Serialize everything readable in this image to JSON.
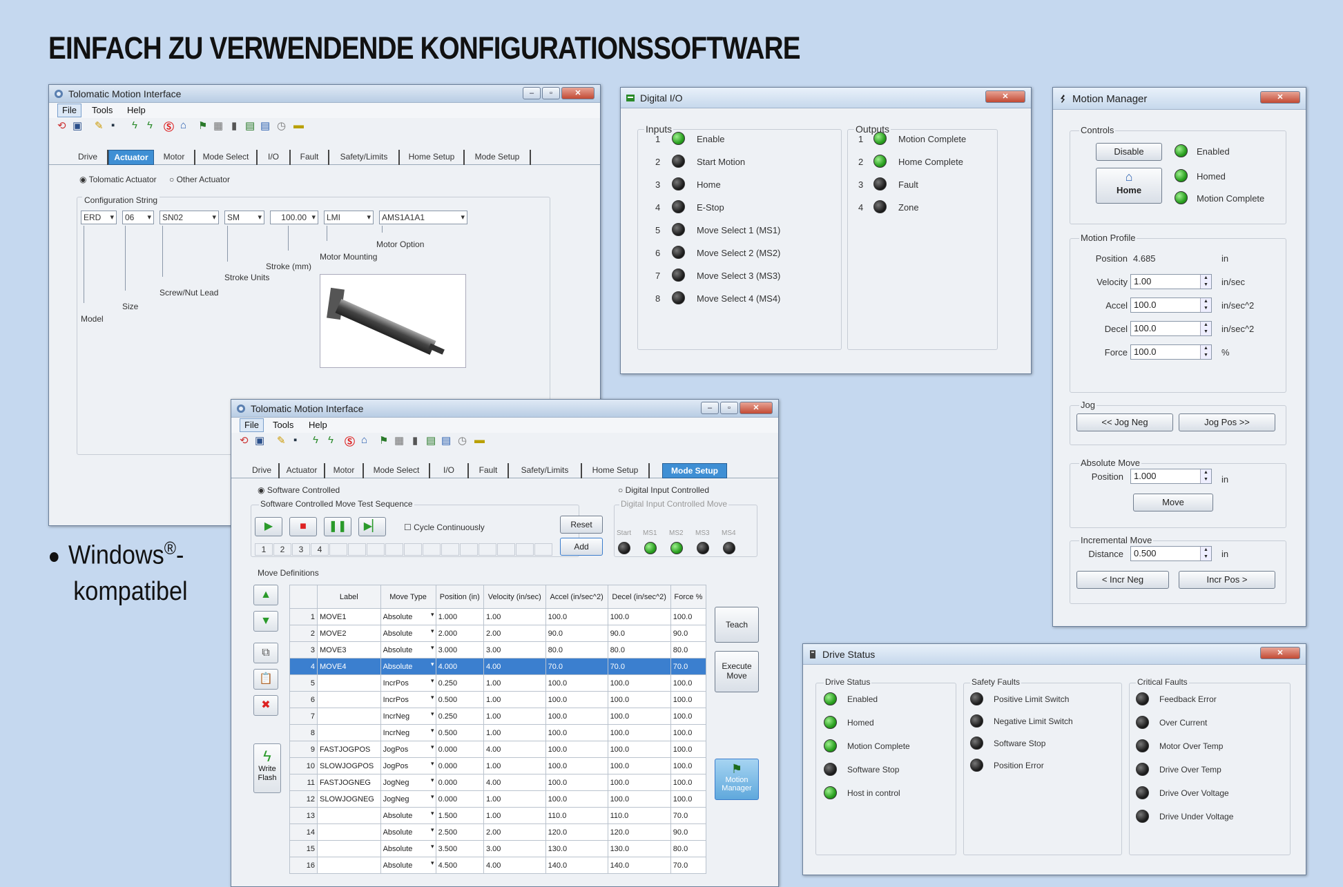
{
  "heading": "EINFACH ZU VERWENDENDE KONFIGURATIONSSOFTWARE",
  "bullet": {
    "line1": "Windows",
    "sup": "®",
    "dash": "-",
    "line2": "kompatibel"
  },
  "colors": {
    "background": "#c5d8ef",
    "selected_tab": "#3f8fd4",
    "led_on": "#2aa020",
    "led_off": "#222222",
    "selected_row": "#3b7fcf"
  },
  "window1": {
    "title": "Tolomatic Motion Interface",
    "menu": [
      "File",
      "Tools",
      "Help"
    ],
    "tabs": [
      "Drive",
      "Actuator",
      "Motor",
      "Mode Select",
      "I/O",
      "Fault",
      "Safety/Limits",
      "Home Setup",
      "Mode Setup"
    ],
    "selected_tab": "Actuator",
    "radio_tolomatic": "Tolomatic Actuator",
    "radio_other": "Other Actuator",
    "config_label": "Configuration String",
    "combos": [
      "ERD",
      "06",
      "SN02",
      "SM",
      "100.00",
      "LMI",
      "AMS1A1A1"
    ],
    "labels": {
      "model": "Model",
      "size": "Size",
      "screw": "Screw/Nut Lead",
      "stroke_units": "Stroke Units",
      "stroke": "Stroke (mm)",
      "motor_mounting": "Motor Mounting",
      "motor_option": "Motor Option"
    }
  },
  "window2": {
    "title": "Tolomatic Motion Interface",
    "menu": [
      "File",
      "Tools",
      "Help"
    ],
    "tabs": [
      "Drive",
      "Actuator",
      "Motor",
      "Mode Select",
      "I/O",
      "Fault",
      "Safety/Limits",
      "Home Setup",
      "Mode Setup"
    ],
    "selected_tab": "Mode Setup",
    "radio_software": "Software Controlled",
    "radio_digital": "Digital Input Controlled",
    "seq_title": "Software Controlled Move Test Sequence",
    "digital_title": "Digital Input Controlled Move",
    "cycle_label": "Cycle Continuously",
    "reset": "Reset",
    "add": "Add",
    "seq_numbers": [
      "1",
      "2",
      "3",
      "4"
    ],
    "digital_leds": [
      {
        "label": "Start",
        "on": false
      },
      {
        "label": "MS1",
        "on": true
      },
      {
        "label": "MS2",
        "on": true
      },
      {
        "label": "MS3",
        "on": false
      },
      {
        "label": "MS4",
        "on": false
      }
    ],
    "move_defs_label": "Move Definitions",
    "columns": [
      "Label",
      "Move Type",
      "Position (in)",
      "Velocity (in/sec)",
      "Accel (in/sec^2)",
      "Decel (in/sec^2)",
      "Force %"
    ],
    "rows": [
      [
        "1",
        "MOVE1",
        "Absolute",
        "1.000",
        "1.00",
        "100.0",
        "100.0",
        "100.0"
      ],
      [
        "2",
        "MOVE2",
        "Absolute",
        "2.000",
        "2.00",
        "90.0",
        "90.0",
        "90.0"
      ],
      [
        "3",
        "MOVE3",
        "Absolute",
        "3.000",
        "3.00",
        "80.0",
        "80.0",
        "80.0"
      ],
      [
        "4",
        "MOVE4",
        "Absolute",
        "4.000",
        "4.00",
        "70.0",
        "70.0",
        "70.0"
      ],
      [
        "5",
        "",
        "IncrPos",
        "0.250",
        "1.00",
        "100.0",
        "100.0",
        "100.0"
      ],
      [
        "6",
        "",
        "IncrPos",
        "0.500",
        "1.00",
        "100.0",
        "100.0",
        "100.0"
      ],
      [
        "7",
        "",
        "IncrNeg",
        "0.250",
        "1.00",
        "100.0",
        "100.0",
        "100.0"
      ],
      [
        "8",
        "",
        "IncrNeg",
        "0.500",
        "1.00",
        "100.0",
        "100.0",
        "100.0"
      ],
      [
        "9",
        "FASTJOGPOS",
        "JogPos",
        "0.000",
        "4.00",
        "100.0",
        "100.0",
        "100.0"
      ],
      [
        "10",
        "SLOWJOGPOS",
        "JogPos",
        "0.000",
        "1.00",
        "100.0",
        "100.0",
        "100.0"
      ],
      [
        "11",
        "FASTJOGNEG",
        "JogNeg",
        "0.000",
        "4.00",
        "100.0",
        "100.0",
        "100.0"
      ],
      [
        "12",
        "SLOWJOGNEG",
        "JogNeg",
        "0.000",
        "1.00",
        "100.0",
        "100.0",
        "100.0"
      ],
      [
        "13",
        "",
        "Absolute",
        "1.500",
        "1.00",
        "110.0",
        "110.0",
        "70.0"
      ],
      [
        "14",
        "",
        "Absolute",
        "2.500",
        "2.00",
        "120.0",
        "120.0",
        "90.0"
      ],
      [
        "15",
        "",
        "Absolute",
        "3.500",
        "3.00",
        "130.0",
        "130.0",
        "80.0"
      ],
      [
        "16",
        "",
        "Absolute",
        "4.500",
        "4.00",
        "140.0",
        "140.0",
        "70.0"
      ]
    ],
    "selected_row": "4",
    "teach": "Teach",
    "execute_move": "Execute Move",
    "motion_manager_btn": "Motion Manager",
    "write_flash": "Write Flash"
  },
  "digital_io": {
    "title": "Digital I/O",
    "inputs_title": "Inputs",
    "outputs_title": "Outputs",
    "inputs": [
      {
        "num": "1",
        "label": "Enable",
        "on": true
      },
      {
        "num": "2",
        "label": "Start Motion",
        "on": false
      },
      {
        "num": "3",
        "label": "Home",
        "on": false
      },
      {
        "num": "4",
        "label": "E-Stop",
        "on": false
      },
      {
        "num": "5",
        "label": "Move Select 1 (MS1)",
        "on": false
      },
      {
        "num": "6",
        "label": "Move Select 2 (MS2)",
        "on": false
      },
      {
        "num": "7",
        "label": "Move Select 3 (MS3)",
        "on": false
      },
      {
        "num": "8",
        "label": "Move Select 4 (MS4)",
        "on": false
      }
    ],
    "outputs": [
      {
        "num": "1",
        "label": "Motion Complete",
        "on": true
      },
      {
        "num": "2",
        "label": "Home Complete",
        "on": true
      },
      {
        "num": "3",
        "label": "Fault",
        "on": false
      },
      {
        "num": "4",
        "label": "Zone",
        "on": false
      }
    ]
  },
  "motion_manager": {
    "title": "Motion Manager",
    "controls_title": "Controls",
    "disable": "Disable",
    "home": "Home",
    "status": [
      {
        "label": "Enabled",
        "on": true
      },
      {
        "label": "Homed",
        "on": true
      },
      {
        "label": "Motion Complete",
        "on": true
      }
    ],
    "profile_title": "Motion Profile",
    "position_label": "Position",
    "position_value": "4.685",
    "position_unit": "in",
    "velocity_label": "Velocity",
    "velocity_value": "1.00",
    "velocity_unit": "in/sec",
    "accel_label": "Accel",
    "accel_value": "100.0",
    "accel_unit": "in/sec^2",
    "decel_label": "Decel",
    "decel_value": "100.0",
    "decel_unit": "in/sec^2",
    "force_label": "Force",
    "force_value": "100.0",
    "force_unit": "%",
    "jog_title": "Jog",
    "jog_neg": "<<  Jog Neg",
    "jog_pos": "Jog Pos  >>",
    "abs_title": "Absolute Move",
    "abs_position_label": "Position",
    "abs_position_value": "1.000",
    "abs_unit": "in",
    "move": "Move",
    "incr_title": "Incremental Move",
    "distance_label": "Distance",
    "distance_value": "0.500",
    "distance_unit": "in",
    "incr_neg": "<  Incr Neg",
    "incr_pos": "Incr Pos  >"
  },
  "drive_status": {
    "title": "Drive Status",
    "col1_title": "Drive Status",
    "col1": [
      {
        "label": "Enabled",
        "on": true
      },
      {
        "label": "Homed",
        "on": true
      },
      {
        "label": "Motion Complete",
        "on": true
      },
      {
        "label": "Software Stop",
        "on": false
      },
      {
        "label": "Host in control",
        "on": true
      }
    ],
    "col2_title": "Safety Faults",
    "col2": [
      {
        "label": "Positive Limit Switch",
        "on": false
      },
      {
        "label": "Negative Limit Switch",
        "on": false
      },
      {
        "label": "Software Stop",
        "on": false
      },
      {
        "label": "Position Error",
        "on": false
      }
    ],
    "col3_title": "Critical Faults",
    "col3": [
      {
        "label": "Feedback Error",
        "on": false
      },
      {
        "label": "Over Current",
        "on": false
      },
      {
        "label": "Motor Over Temp",
        "on": false
      },
      {
        "label": "Drive Over Temp",
        "on": false
      },
      {
        "label": "Drive Over Voltage",
        "on": false
      },
      {
        "label": "Drive Under Voltage",
        "on": false
      }
    ]
  }
}
